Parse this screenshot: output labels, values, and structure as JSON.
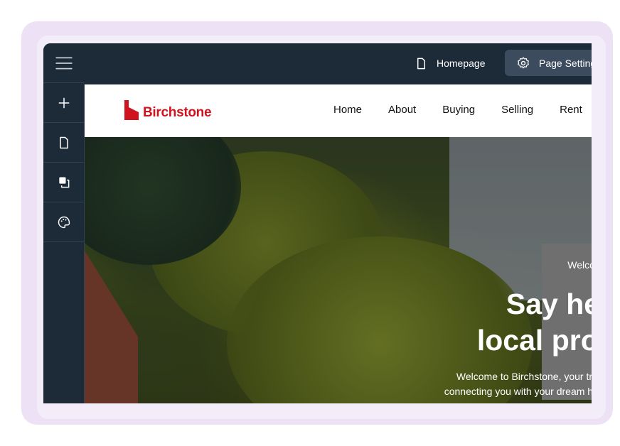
{
  "editor": {
    "menu_icon": "hamburger-icon",
    "rail": [
      {
        "icon": "plus-icon"
      },
      {
        "icon": "page-icon"
      },
      {
        "icon": "layers-icon"
      },
      {
        "icon": "palette-icon"
      }
    ],
    "topbar": {
      "page_label": "Homepage",
      "settings_label": "Page Settings"
    }
  },
  "site": {
    "logo_text": "Birchstone",
    "nav": [
      "Home",
      "About",
      "Buying",
      "Selling",
      "Rent"
    ],
    "hero": {
      "kicker": "Welcome to Birchstone",
      "headline_line1": "Say hello to",
      "headline_line2": "local property",
      "sub_line1": "Welcome to Birchstone, your trusted local estate",
      "sub_line2": "connecting you with your dream home, offering exp"
    }
  },
  "colors": {
    "card_bg": "#ece1f5",
    "editor_dark": "#1d2a38",
    "settings_button": "#3c4b5d",
    "brand_red": "#d0141f"
  }
}
